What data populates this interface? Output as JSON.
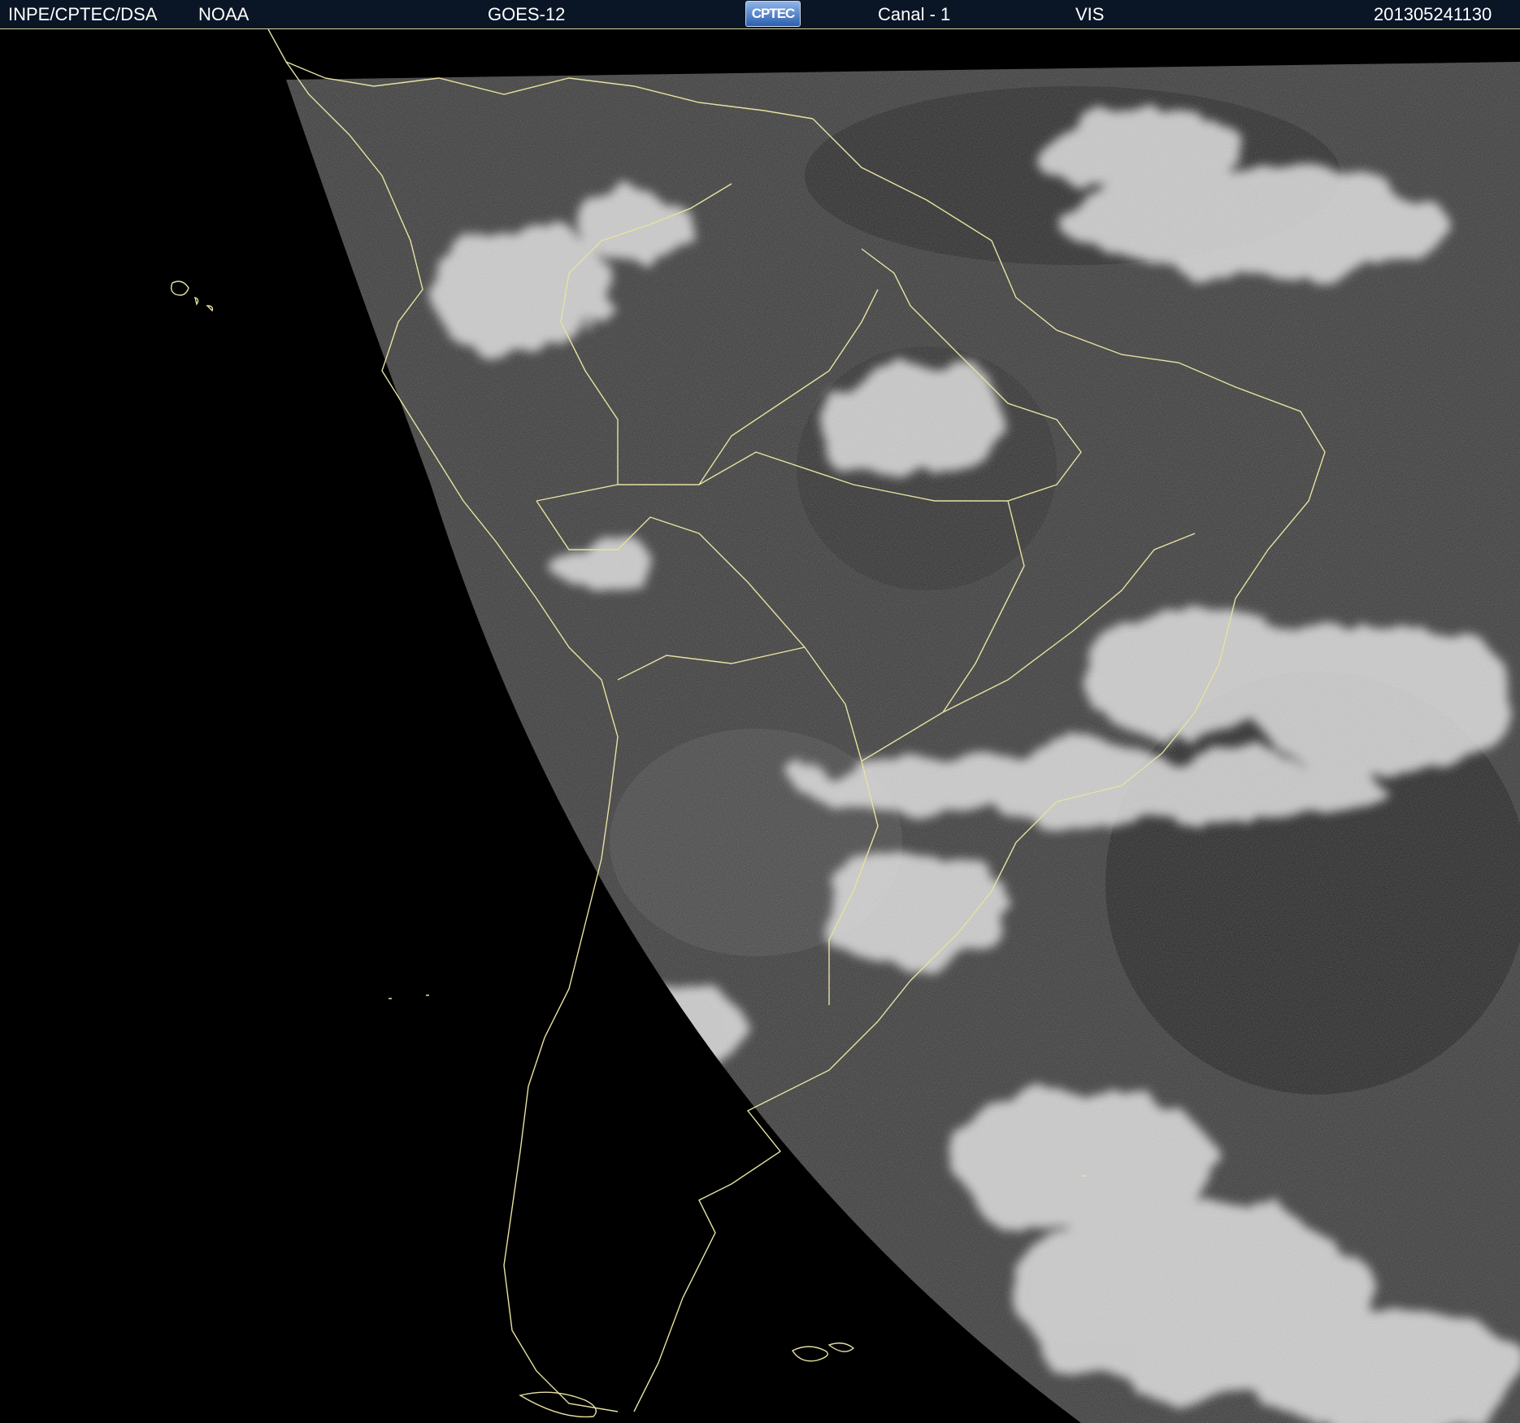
{
  "header": {
    "agency": "INPE/CPTEC/DSA",
    "operator": "NOAA",
    "satellite": "GOES-12",
    "logo_text": "CPTEC",
    "channel": "Canal - 1",
    "band": "VIS",
    "timestamp": "201305241130"
  },
  "colors": {
    "header_bg": "#0a1626",
    "header_text": "#ffffff",
    "coastline": "#e6e2a0",
    "space": "#000000",
    "cloud_bright": "#f2f2f2",
    "ocean_dark": "#2c2c2c"
  },
  "image": {
    "type": "satellite-visible",
    "region": "South America",
    "product_icon": "cptec-logo-icon"
  }
}
